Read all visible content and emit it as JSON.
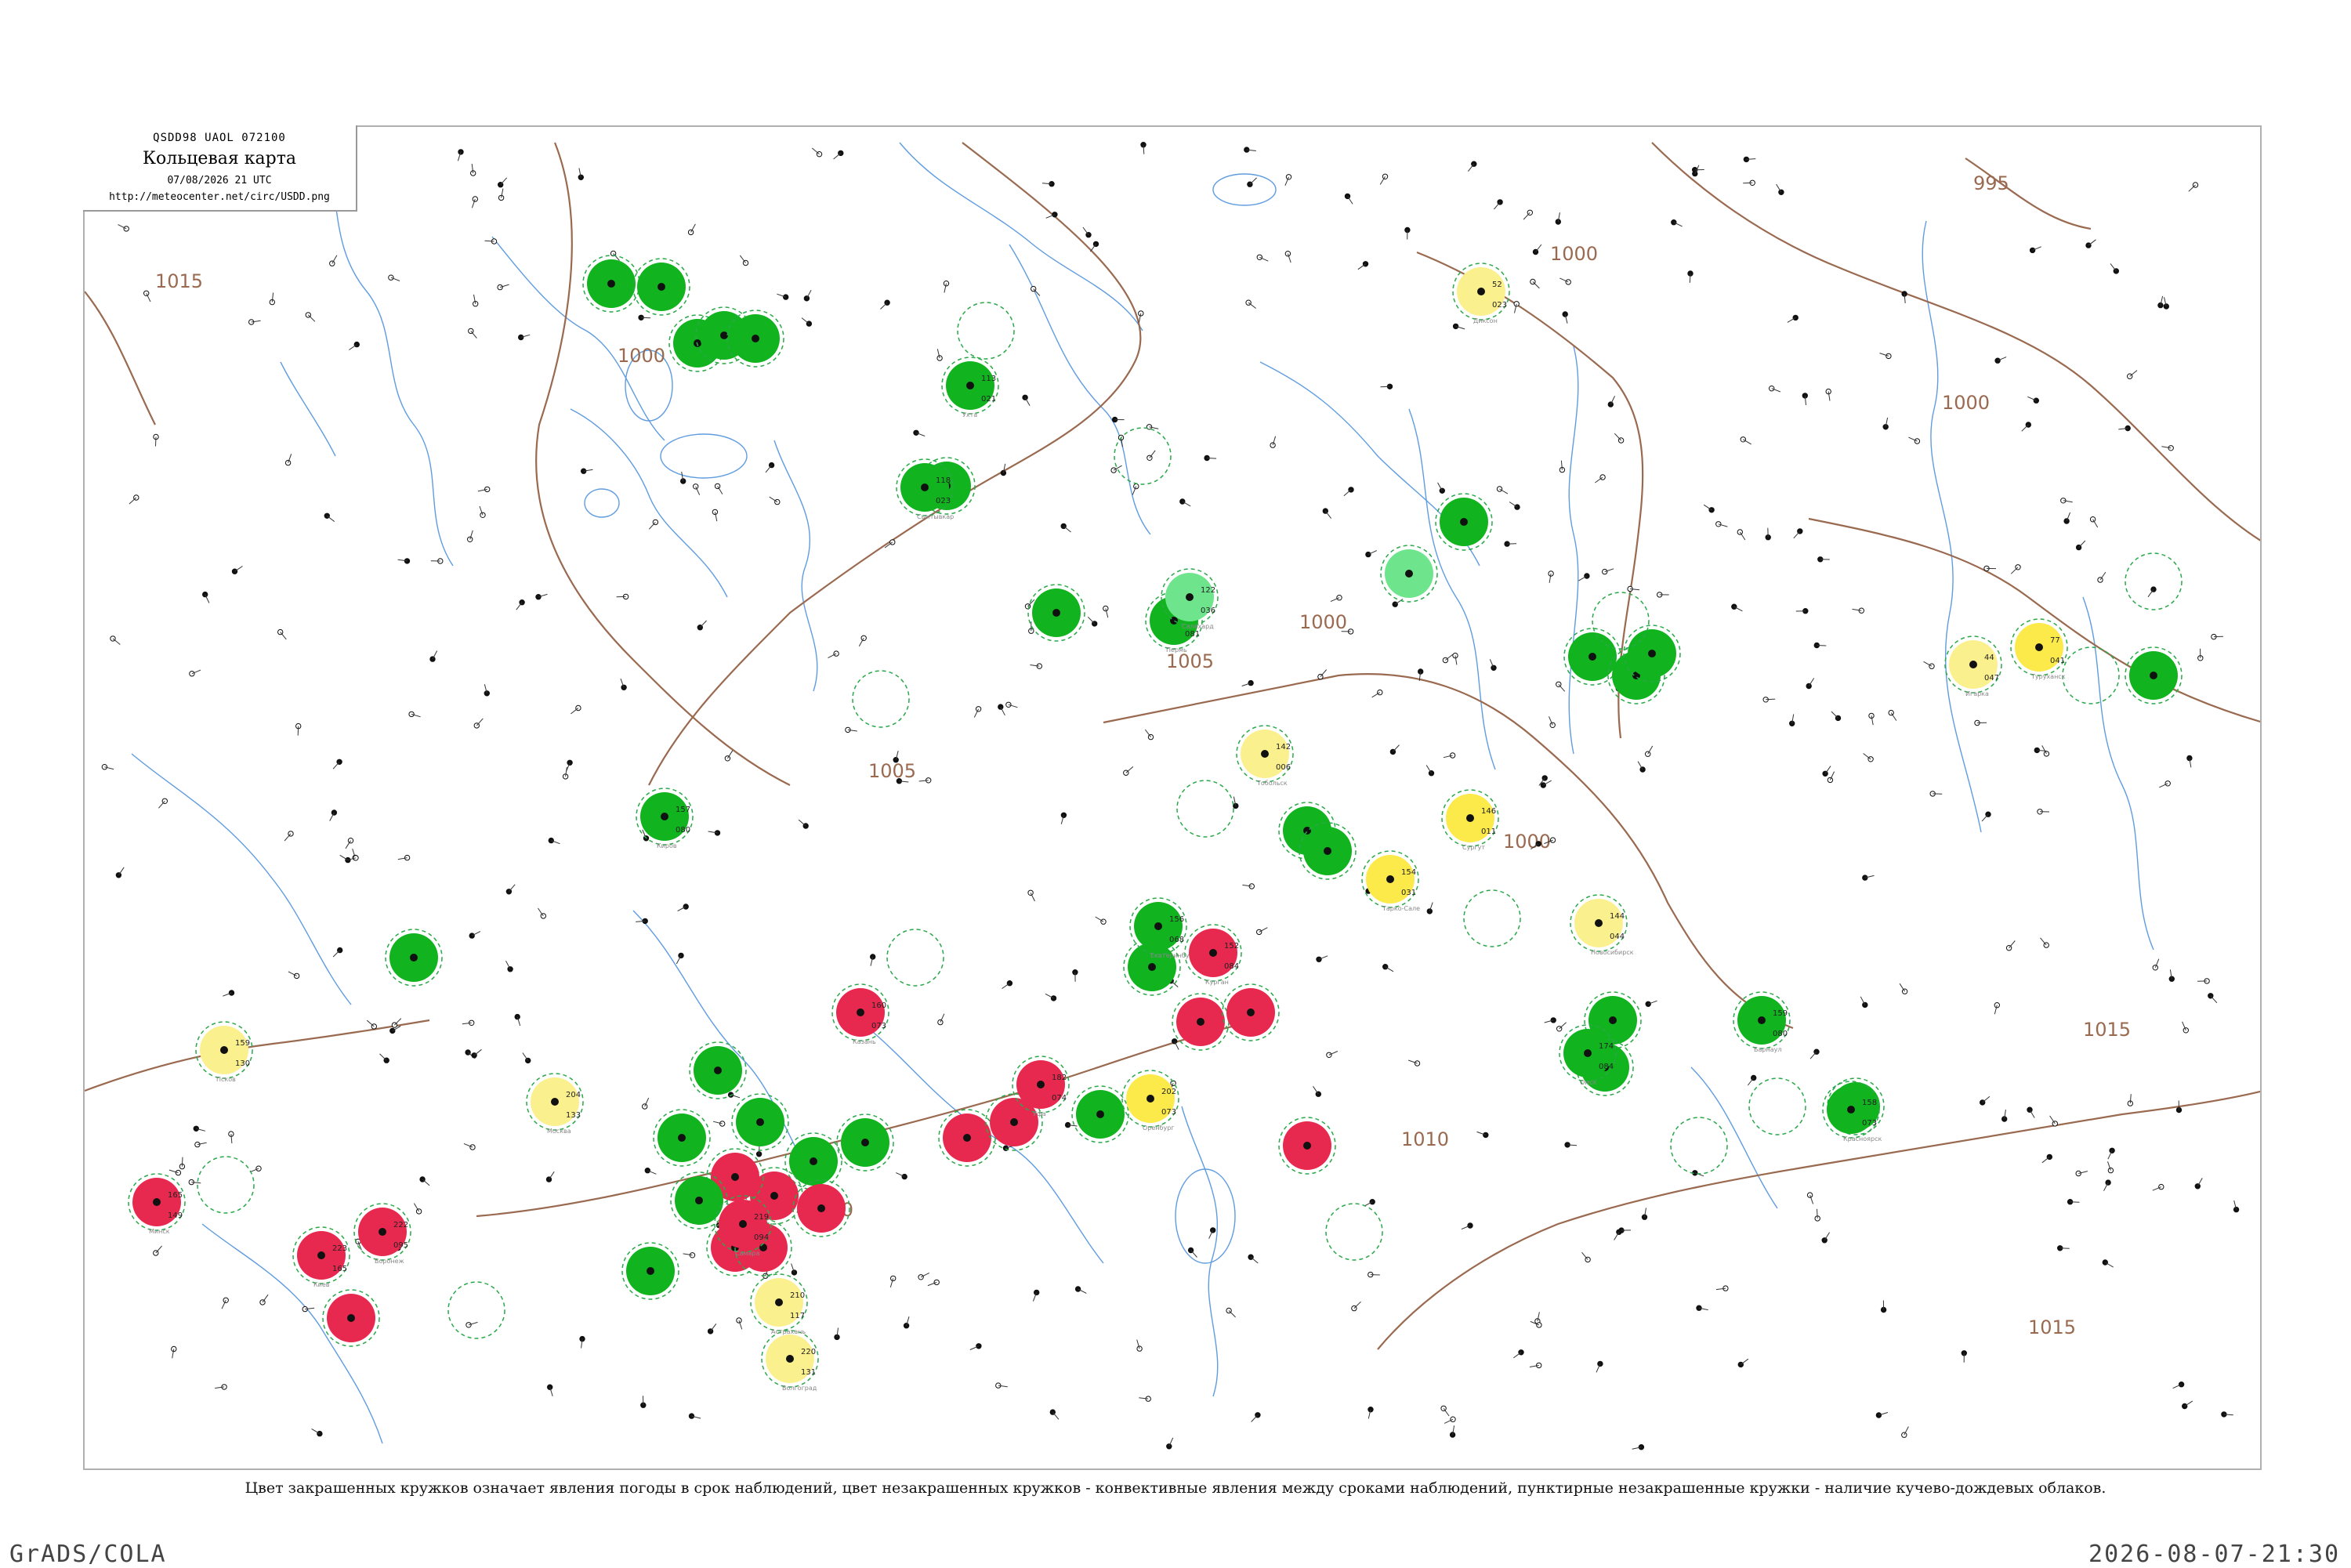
{
  "header": {
    "code": "QSDD98  UAOL  072100",
    "title": "Кольцевая карта",
    "date": "07/08/2026 21 UTC",
    "url": "http://meteocenter.net/circ/USDD.png"
  },
  "caption": "Цвет закрашенных кружков означает явления погоды в срок наблюдений, цвет незакрашенных кружков - конвективные явления между сроками наблюдений, пунктирные незакрашенные кружки - наличие кучево-дождевых облаков.",
  "footer": {
    "left": "GrADS/COLA",
    "right": "2026-08-07-21:30"
  },
  "colors": {
    "green": "#11b31f",
    "red": "#e8294f",
    "yellow": "#fbea4a",
    "pale_yellow": "#fbf08e",
    "light_green": "#6ee58c",
    "isobar": "#9a6a50",
    "river": "#2a7bd6",
    "dashed_green": "#2aa84a"
  },
  "isobars": [
    {
      "label": "995"
    },
    {
      "label": "1000"
    },
    {
      "label": "1005"
    },
    {
      "label": "1010"
    },
    {
      "label": "1015"
    }
  ],
  "stations": [
    {
      "name": "Сыктывкар",
      "temp": "118",
      "pressure": "023",
      "state": "green"
    },
    {
      "name": "Ухта",
      "temp": "113",
      "pressure": "021",
      "state": "green"
    },
    {
      "name": "Киров",
      "temp": "157",
      "pressure": "080",
      "state": "green"
    },
    {
      "name": "Пермь",
      "temp": "156",
      "pressure": "081",
      "state": "green"
    },
    {
      "name": "Екатеринбург",
      "temp": "156",
      "pressure": "068",
      "state": "green"
    },
    {
      "name": "Казань",
      "temp": "160",
      "pressure": "073",
      "state": "red"
    },
    {
      "name": "Уфа",
      "temp": "182",
      "pressure": "074",
      "state": "red"
    },
    {
      "name": "Самара",
      "temp": "219",
      "pressure": "094",
      "state": "red"
    },
    {
      "name": "Оренбург",
      "temp": "202",
      "pressure": "073",
      "state": "yellow"
    },
    {
      "name": "Курган",
      "temp": "152",
      "pressure": "084",
      "state": "red"
    },
    {
      "name": "Омск",
      "temp": "174",
      "pressure": "084",
      "state": "green"
    },
    {
      "name": "Новосибирск",
      "temp": "144",
      "pressure": "044",
      "state": "pale_yellow"
    },
    {
      "name": "Тобольск",
      "temp": "142",
      "pressure": "006",
      "state": "pale_yellow"
    },
    {
      "name": "Сургут",
      "temp": "146",
      "pressure": "011",
      "state": "yellow"
    },
    {
      "name": "Тарко-Сале",
      "temp": "154",
      "pressure": "031",
      "state": "yellow"
    },
    {
      "name": "Салехард",
      "temp": "122",
      "pressure": "036",
      "state": "light_green"
    },
    {
      "name": "Диксон",
      "temp": "52",
      "pressure": "023",
      "state": "pale_yellow"
    },
    {
      "name": "Туруханск",
      "temp": "77",
      "pressure": "041",
      "state": "yellow"
    },
    {
      "name": "Игарка",
      "temp": "44",
      "pressure": "047",
      "state": "pale_yellow"
    },
    {
      "name": "Красноярск",
      "temp": "158",
      "pressure": "073",
      "state": "green"
    },
    {
      "name": "Барнаул",
      "temp": "159",
      "pressure": "080",
      "state": "green"
    },
    {
      "name": "Москва",
      "temp": "204",
      "pressure": "133",
      "state": "pale_yellow"
    },
    {
      "name": "Воронеж",
      "temp": "222",
      "pressure": "095",
      "state": "red"
    },
    {
      "name": "Волгоград",
      "temp": "220",
      "pressure": "131",
      "state": "pale_yellow"
    },
    {
      "name": "Астрахань",
      "temp": "210",
      "pressure": "117",
      "state": "pale_yellow"
    },
    {
      "name": "Псков",
      "temp": "159",
      "pressure": "130",
      "state": "pale_yellow"
    },
    {
      "name": "Минск",
      "temp": "165",
      "pressure": "149",
      "state": "red"
    },
    {
      "name": "Киев",
      "temp": "223",
      "pressure": "165",
      "state": "red"
    }
  ]
}
